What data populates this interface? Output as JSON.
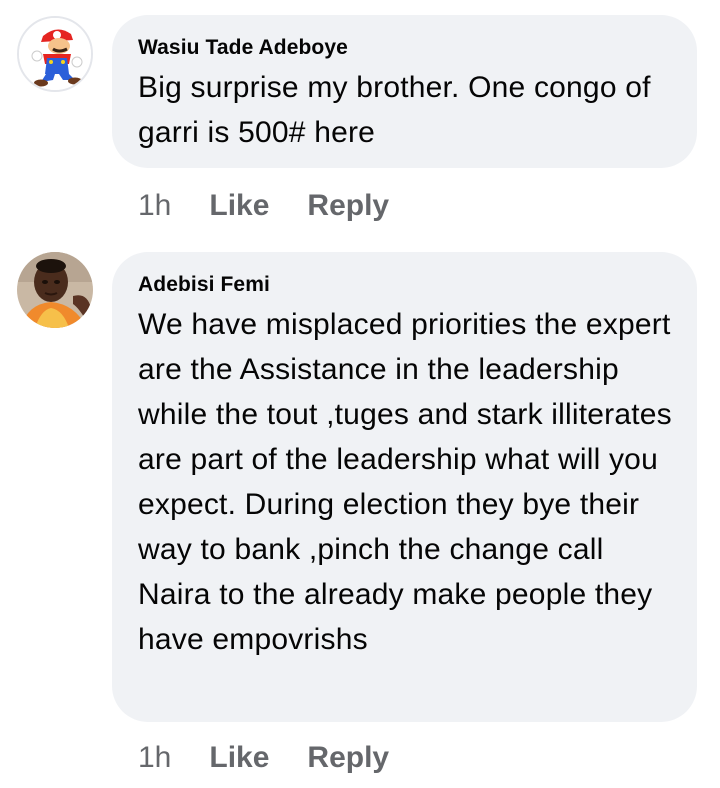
{
  "comments": [
    {
      "author": "Wasiu Tade Adeboye",
      "avatar_icon": "mario-character-icon",
      "text": "Big surprise my brother. One congo of garri is 500# here",
      "time": "1h",
      "like_label": "Like",
      "reply_label": "Reply"
    },
    {
      "author": "Adebisi Femi",
      "avatar_icon": "profile-photo-icon",
      "text": "We have misplaced priorities the expert are the Assistance in the leadership while the tout ,tuges and stark illiterates are part of the leadership what will you expect. During election they bye their way to bank ,pinch the change call Naira to the already make people they have empovrishs",
      "time": "1h",
      "like_label": "Like",
      "reply_label": "Reply"
    }
  ],
  "colors": {
    "bubble_bg": "#f0f2f5",
    "text": "#050505",
    "secondary_text": "#65676b"
  }
}
